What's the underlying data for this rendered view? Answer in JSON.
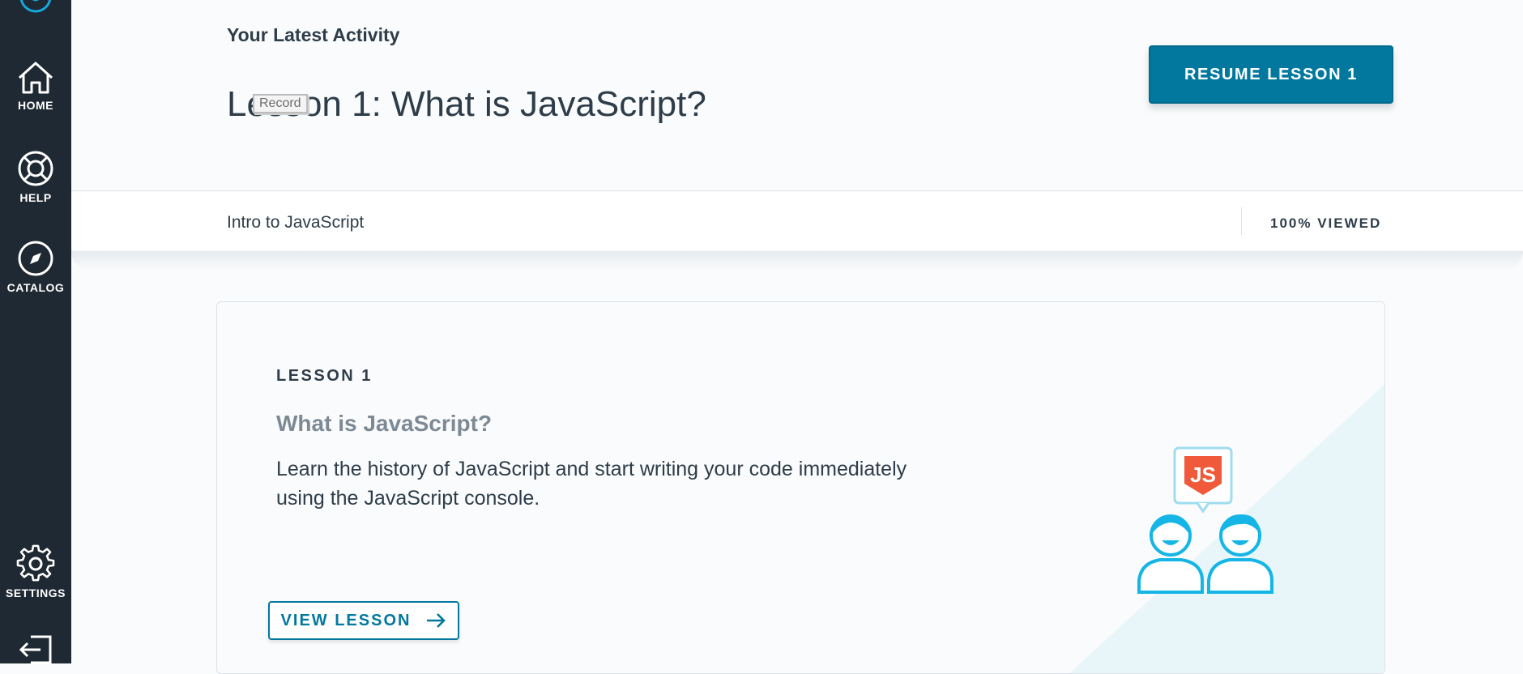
{
  "sidebar": {
    "logo_icon": "udacity-logo-icon",
    "items": [
      {
        "label": "HOME",
        "icon": "home-icon"
      },
      {
        "label": "HELP",
        "icon": "lifebuoy-icon"
      },
      {
        "label": "CATALOG",
        "icon": "compass-icon"
      },
      {
        "label": "SETTINGS",
        "icon": "gear-icon"
      },
      {
        "label": "",
        "icon": "logout-icon"
      }
    ]
  },
  "header": {
    "activity_label": "Your Latest Activity",
    "lesson_heading": "Lesson 1: What is JavaScript?",
    "record_tooltip": "Record",
    "resume_button": "RESUME LESSON 1"
  },
  "progress": {
    "course_name": "Intro to JavaScript",
    "viewed": "100% VIEWED",
    "viewed_percent": 100
  },
  "lesson_card": {
    "number": "LESSON 1",
    "title": "What is JavaScript?",
    "description": "Learn the history of JavaScript and start writing your code immediately using the JavaScript console.",
    "view_button": "VIEW LESSON",
    "illustration_text": "JS"
  },
  "colors": {
    "sidebar": "#1f2933",
    "accent": "#02789f",
    "text": "#2e3d49",
    "illustration_blue": "#15b5e6",
    "js_badge": "#f05a3a"
  }
}
